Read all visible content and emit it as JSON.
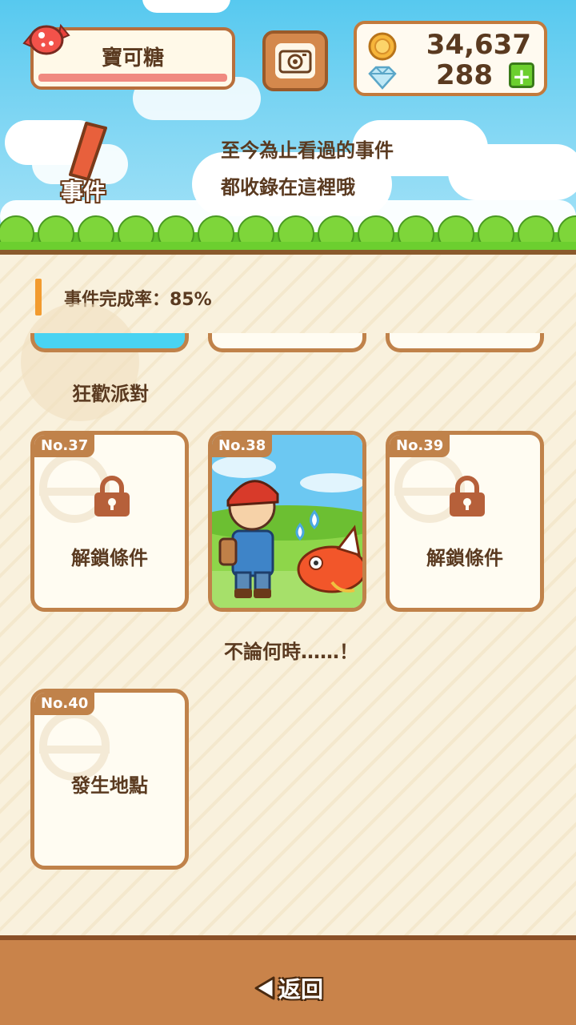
{
  "header": {
    "candy_title": "寶可糖",
    "coins": "34,637",
    "gems": "288",
    "plus_label": "+",
    "event_tag": "事件",
    "intro_line1": "至今為止看過的事件",
    "intro_line2": "都收錄在這裡哦"
  },
  "progress": {
    "completion_label": "事件完成率：85%"
  },
  "rows": {
    "prev_title": "狂歡派對",
    "row2_title": "不論何時……！"
  },
  "cards": [
    {
      "num": "No.37",
      "label": "解鎖條件"
    },
    {
      "num": "No.38",
      "label": ""
    },
    {
      "num": "No.39",
      "label": "解鎖條件"
    },
    {
      "num": "No.40",
      "label": "發生地點"
    }
  ],
  "footer": {
    "back_label": "返回"
  },
  "icons": {
    "candy": "candy-icon",
    "camera": "camera-icon",
    "coin": "coin-icon",
    "gem": "diamond-icon",
    "lock": "lock-icon",
    "back": "back-arrow-icon"
  },
  "colors": {
    "card_border": "#c0824a",
    "accent_orange": "#f29b2f",
    "plus_green": "#6ccf2f"
  }
}
